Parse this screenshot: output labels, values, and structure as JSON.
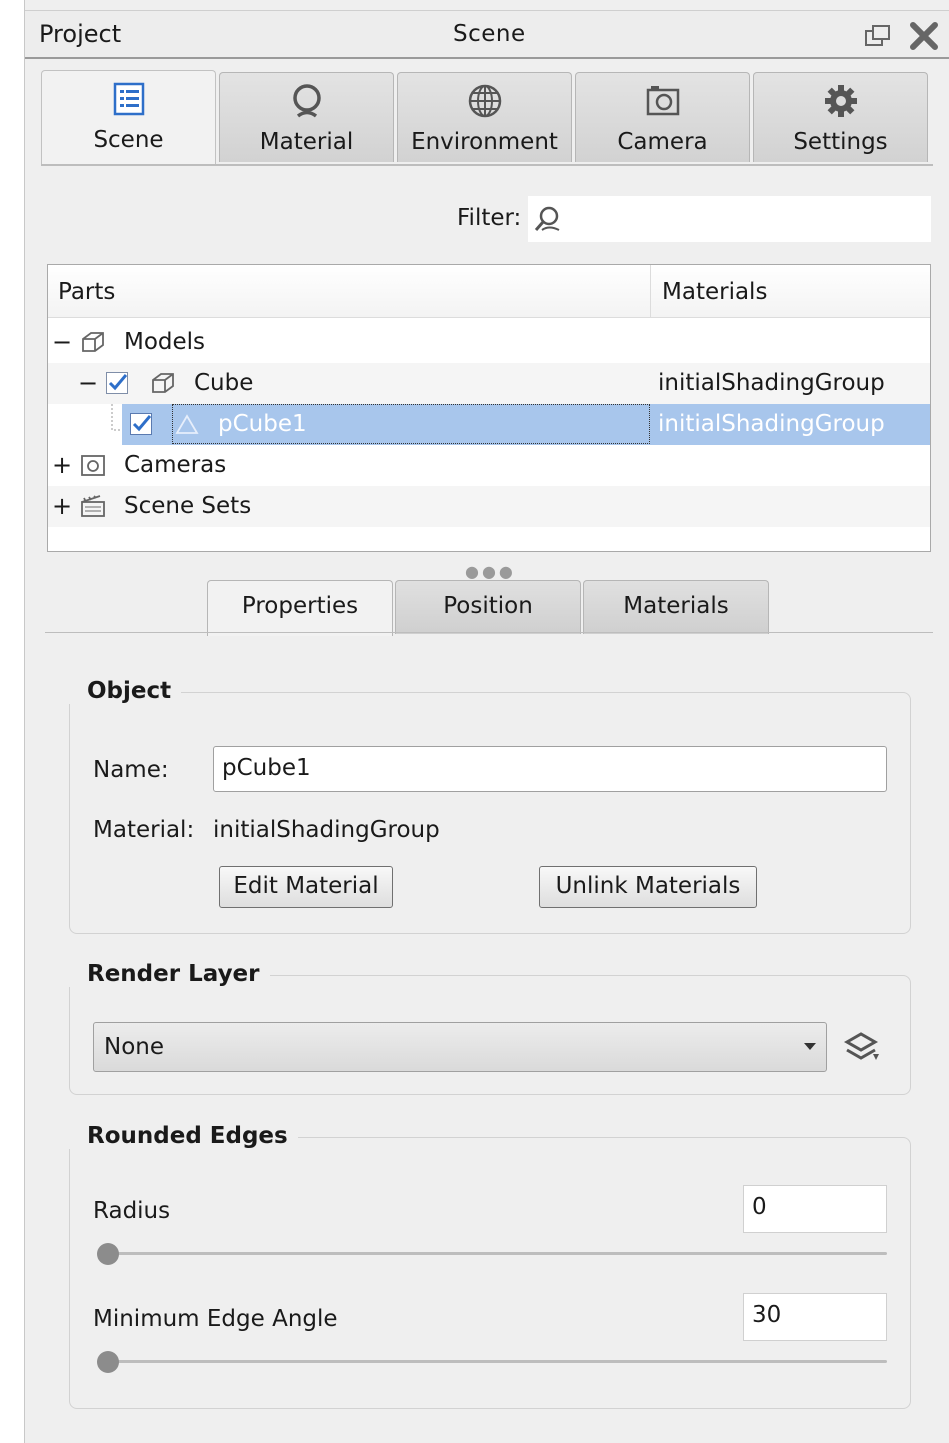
{
  "titlebar": {
    "left_title": "Project",
    "center_title": "Scene"
  },
  "tabs": [
    {
      "label": "Scene",
      "icon": "list-icon"
    },
    {
      "label": "Material",
      "icon": "material-ball-icon"
    },
    {
      "label": "Environment",
      "icon": "globe-icon"
    },
    {
      "label": "Camera",
      "icon": "camera-icon"
    },
    {
      "label": "Settings",
      "icon": "gear-icon"
    }
  ],
  "filter": {
    "label": "Filter:",
    "value": ""
  },
  "tree": {
    "headers": {
      "parts": "Parts",
      "materials": "Materials"
    },
    "rows": [
      {
        "expander": "−",
        "label": "Models",
        "material": ""
      },
      {
        "expander": "−",
        "label": "Cube",
        "material": "initialShadingGroup",
        "checked": true
      },
      {
        "expander": "",
        "label": "pCube1",
        "material": "initialShadingGroup",
        "checked": true,
        "selected": true
      },
      {
        "expander": "+",
        "label": "Cameras",
        "material": ""
      },
      {
        "expander": "+",
        "label": "Scene Sets",
        "material": ""
      }
    ]
  },
  "lower_tabs": [
    "Properties",
    "Position",
    "Materials"
  ],
  "object_group": {
    "title": "Object",
    "name_label": "Name:",
    "name_value": "pCube1",
    "material_label": "Material:",
    "material_value": "initialShadingGroup",
    "edit_button": "Edit Material",
    "unlink_button": "Unlink Materials"
  },
  "render_layer": {
    "title": "Render Layer",
    "selected": "None"
  },
  "rounded_edges": {
    "title": "Rounded Edges",
    "radius_label": "Radius",
    "radius_value": "0",
    "angle_label": "Minimum Edge Angle",
    "angle_value": "30"
  }
}
